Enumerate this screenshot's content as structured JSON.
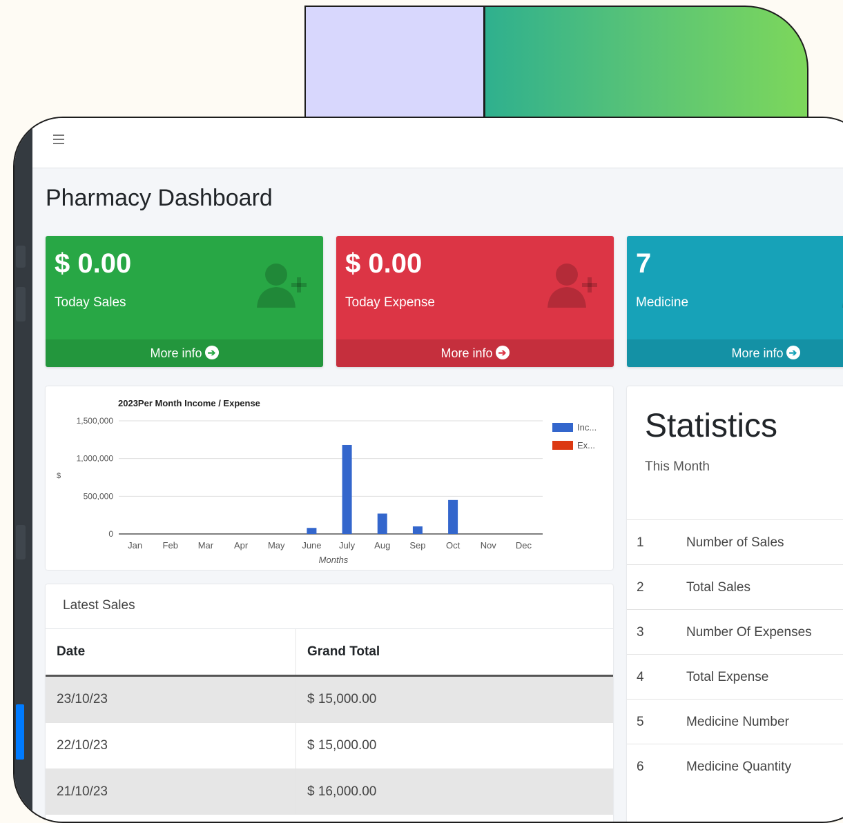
{
  "header": {
    "menu_icon": "hamburger-menu-icon"
  },
  "page": {
    "title": "Pharmacy Dashboard"
  },
  "cards": [
    {
      "value": "$ 0.00",
      "label": "Today Sales",
      "footer": "More info",
      "icon": "user-plus-icon",
      "color": "#28a745"
    },
    {
      "value": "$ 0.00",
      "label": "Today Expense",
      "footer": "More info",
      "icon": "user-plus-icon",
      "color": "#dc3545"
    },
    {
      "value": "7",
      "label": "Medicine",
      "footer": "More info",
      "icon": "user-plus-icon",
      "color": "#17a2b8"
    }
  ],
  "chart_data": {
    "type": "bar",
    "title": "2023Per Month Income / Expense",
    "xlabel": "Months",
    "ylabel": "$",
    "ylim": [
      0,
      1500000
    ],
    "yticks": [
      "1,500,000",
      "1,000,000",
      "500,000",
      "0"
    ],
    "categories": [
      "Jan",
      "Feb",
      "Mar",
      "Apr",
      "May",
      "June",
      "July",
      "Aug",
      "Sep",
      "Oct",
      "Nov",
      "Dec"
    ],
    "series": [
      {
        "name": "Inc...",
        "color": "#3366cc",
        "values": [
          0,
          0,
          0,
          0,
          0,
          80000,
          1180000,
          270000,
          100000,
          450000,
          0,
          0
        ]
      },
      {
        "name": "Ex...",
        "color": "#dc3912",
        "values": [
          0,
          0,
          0,
          0,
          0,
          0,
          0,
          0,
          0,
          0,
          0,
          0
        ]
      }
    ],
    "legend": "right",
    "grid": true
  },
  "latest_sales": {
    "title": "Latest Sales",
    "columns": [
      "Date",
      "Grand Total"
    ],
    "rows": [
      [
        "23/10/23",
        "$ 15,000.00"
      ],
      [
        "22/10/23",
        "$ 15,000.00"
      ],
      [
        "21/10/23",
        "$ 16,000.00"
      ]
    ]
  },
  "statistics": {
    "title": "Statistics",
    "subtitle": "This Month",
    "items": [
      {
        "num": "1",
        "label": "Number of Sales"
      },
      {
        "num": "2",
        "label": "Total Sales"
      },
      {
        "num": "3",
        "label": "Number Of Expenses"
      },
      {
        "num": "4",
        "label": "Total Expense"
      },
      {
        "num": "5",
        "label": "Medicine Number"
      },
      {
        "num": "6",
        "label": "Medicine Quantity"
      }
    ]
  }
}
